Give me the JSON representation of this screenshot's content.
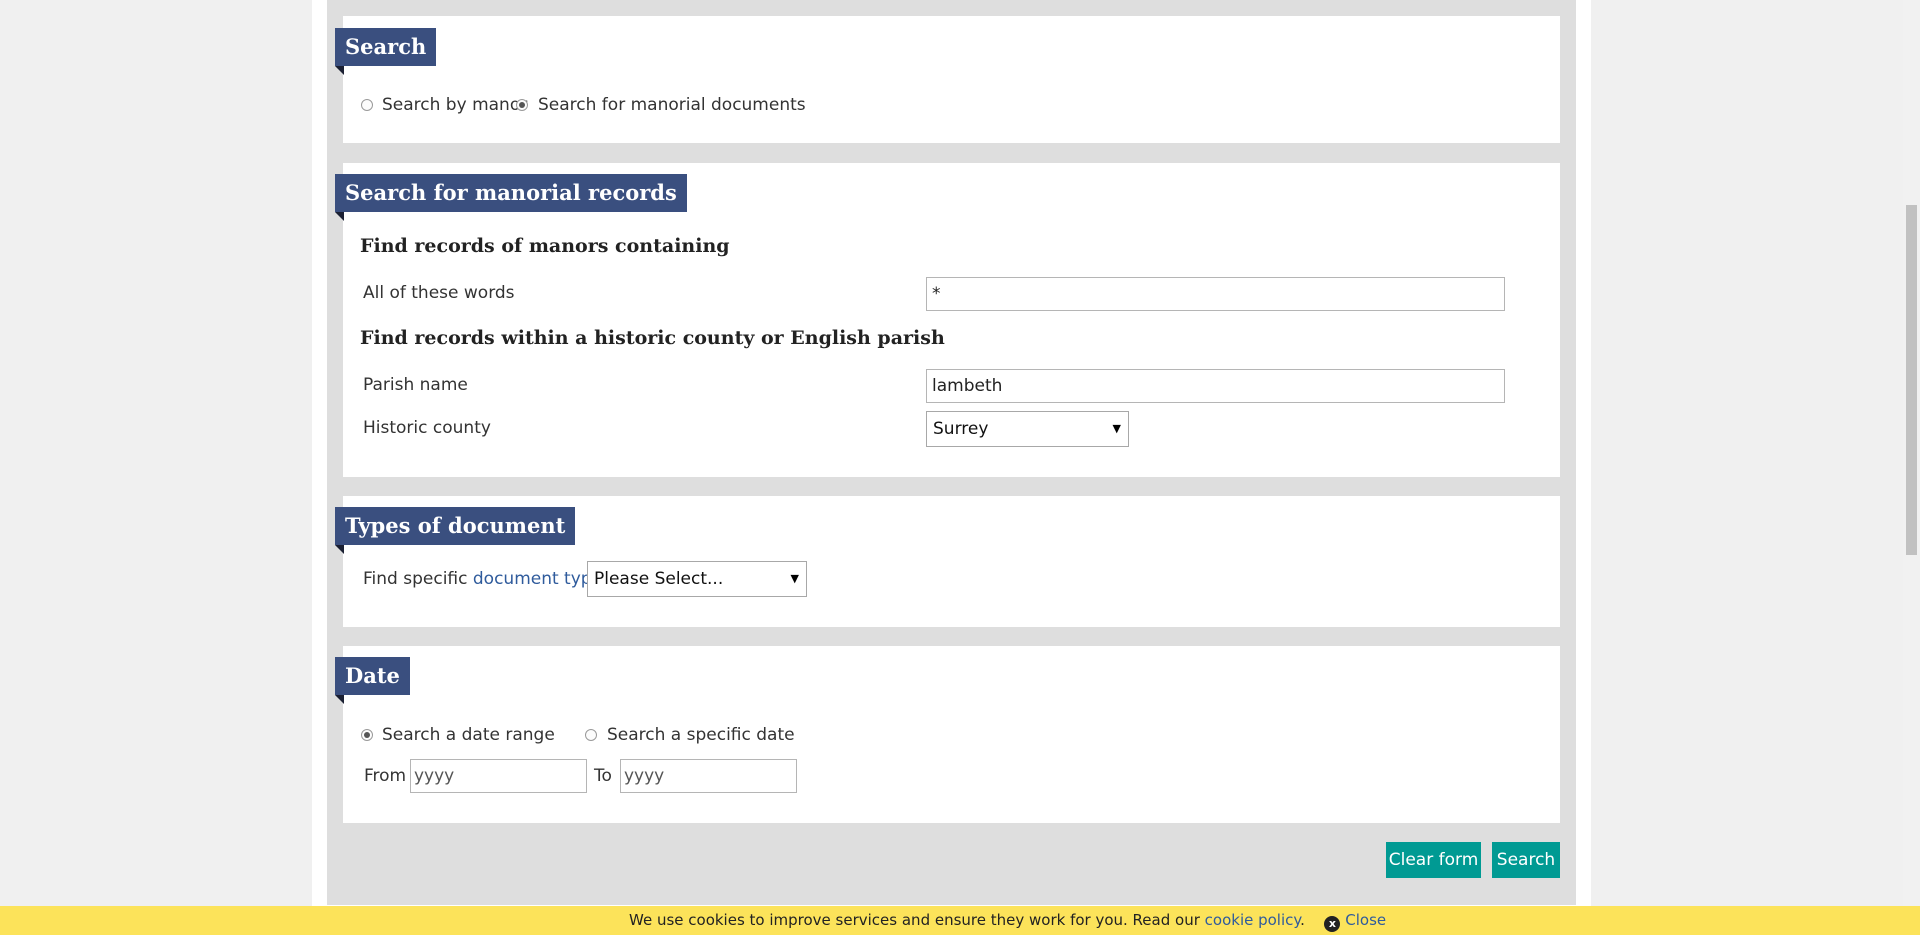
{
  "search_section": {
    "heading": "Search",
    "radio_manor_label": "Search by manor",
    "radio_documents_label": "Search for manorial documents",
    "selected": "documents"
  },
  "records_section": {
    "heading": "Search for manorial records",
    "manors_heading": "Find records of manors containing",
    "all_words_label": "All of these words",
    "all_words_value": "*",
    "county_heading": "Find records within a historic county or English parish",
    "parish_label": "Parish name",
    "parish_value": "lambeth",
    "county_label": "Historic county",
    "county_value": "Surrey"
  },
  "types_section": {
    "heading": "Types of document",
    "find_prefix": "Find specific",
    "doc_types_link": "document types",
    "doc_types_value": "Please Select..."
  },
  "date_section": {
    "heading": "Date",
    "range_label": "Search a date range",
    "specific_label": "Search a specific date",
    "selected": "range",
    "from_label": "From",
    "from_placeholder": "yyyy",
    "to_label": "To",
    "to_placeholder": "yyyy"
  },
  "actions": {
    "clear_label": "Clear form",
    "search_label": "Search"
  },
  "cookie_bar": {
    "text": "We use cookies to improve services and ensure they work for you. Read our",
    "link": "cookie policy",
    "period": ".",
    "close_label": "Close",
    "close_icon_glyph": "x",
    "background": "#fce35a"
  },
  "colors": {
    "heading_bg": "#3a4f7f",
    "button_bg": "#009a93",
    "link": "#2f5b9c"
  }
}
